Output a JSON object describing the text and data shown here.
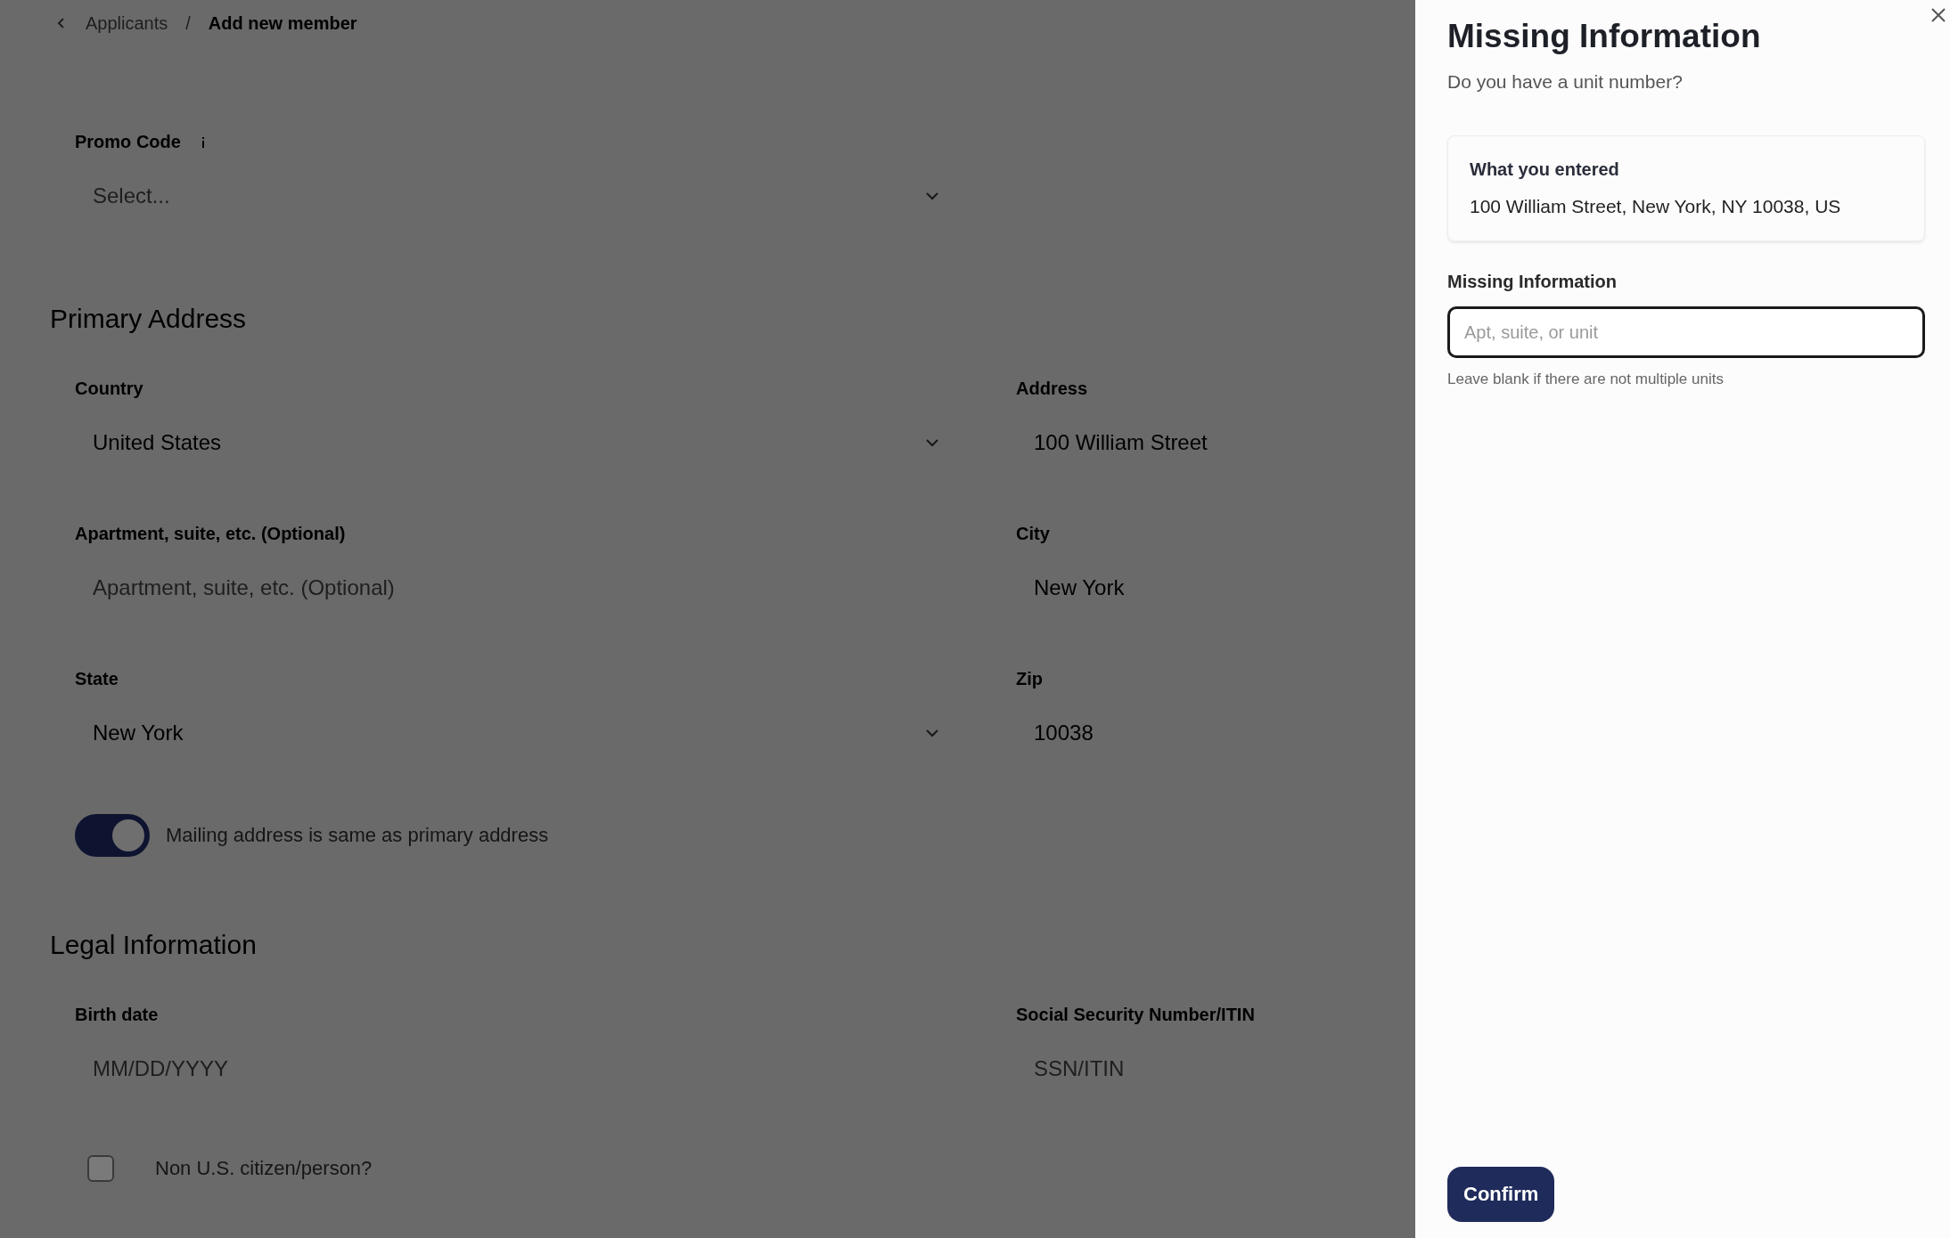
{
  "breadcrumb": {
    "items": [
      "Applicants",
      "Add new member"
    ],
    "separator": "/"
  },
  "promo_code": {
    "label": "Promo Code",
    "placeholder": "Select..."
  },
  "sections": [
    {
      "title": "Primary Address",
      "fields": [
        {
          "kind": "select",
          "label": "Country",
          "value": "United States"
        },
        {
          "kind": "text",
          "label": "Address",
          "value": "100 William Street"
        },
        {
          "kind": "text",
          "label": "Apartment, suite, etc. (Optional)",
          "placeholder": "Apartment, suite, etc. (Optional)"
        },
        {
          "kind": "text",
          "label": "City",
          "value": "New York"
        },
        {
          "kind": "select",
          "label": "State",
          "value": "New York"
        },
        {
          "kind": "text",
          "label": "Zip",
          "value": "10038"
        }
      ],
      "toggle": {
        "label": "Mailing address is same as primary address",
        "on": true
      }
    },
    {
      "title": "Legal Information",
      "fields": [
        {
          "kind": "text",
          "label": "Birth date",
          "placeholder": "MM/DD/YYYY"
        },
        {
          "kind": "text",
          "label": "Social Security Number/ITIN",
          "placeholder": "SSN/ITIN"
        }
      ],
      "checkbox": {
        "label": "Non U.S. citizen/person?",
        "checked": false
      }
    }
  ],
  "drawer": {
    "title": "Missing Information",
    "subtitle": "Do you have a unit number?",
    "entered": {
      "heading": "What you entered",
      "value": "100 William Street, New York, NY 10038, US"
    },
    "field": {
      "label": "Missing Information",
      "placeholder": "Apt, suite, or unit",
      "hint": "Leave blank if there are not multiple units"
    },
    "confirm": "Confirm"
  }
}
